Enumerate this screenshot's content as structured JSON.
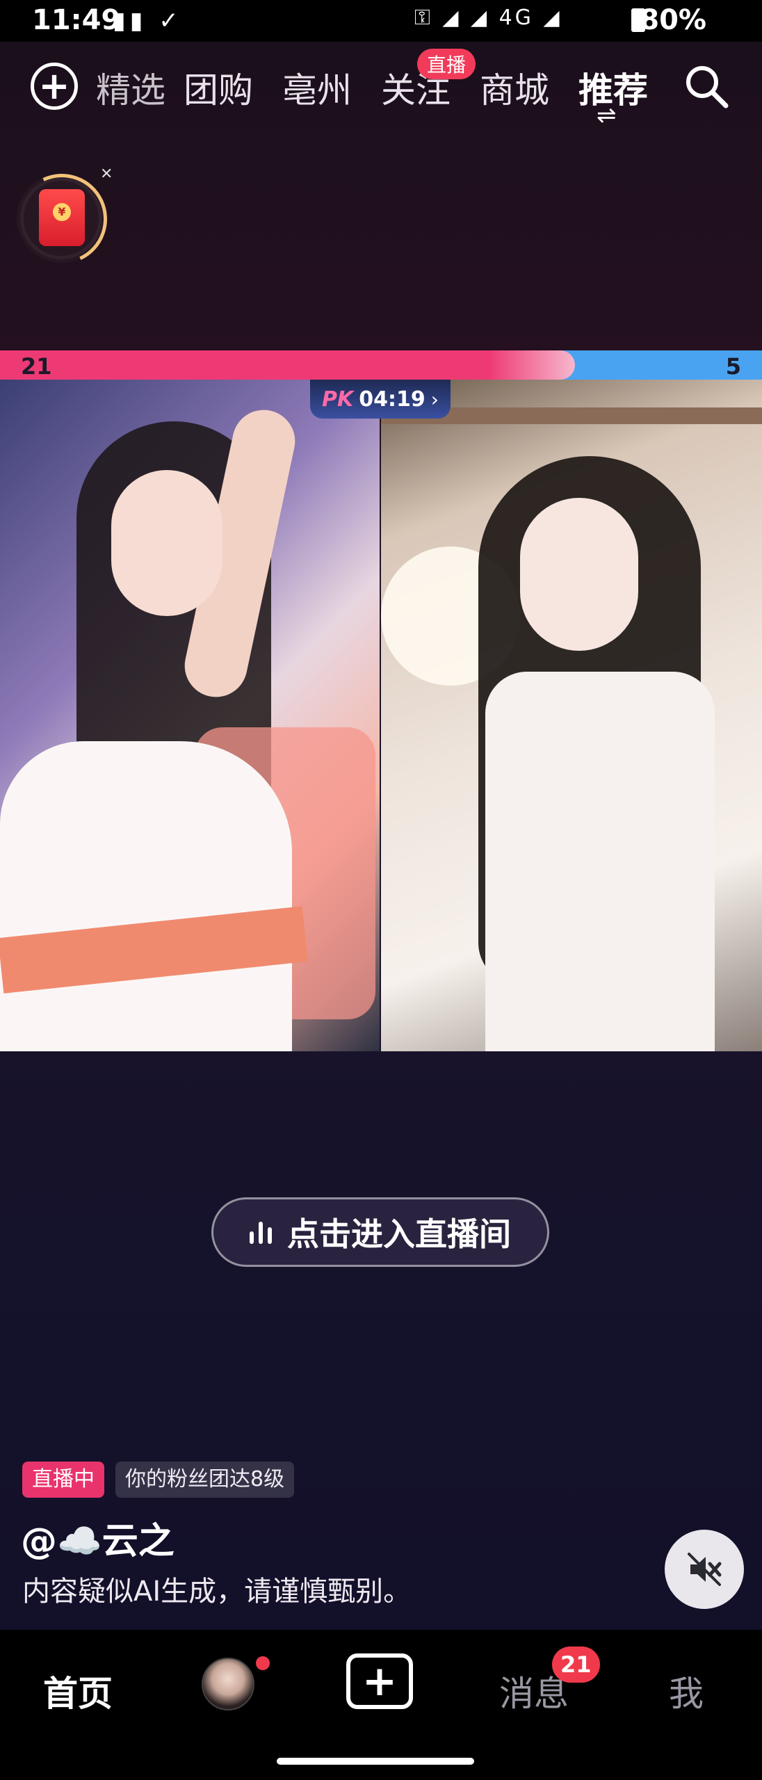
{
  "status_bar": {
    "time": "11:49",
    "battery_pct": "80%",
    "network": "4G"
  },
  "top_nav": {
    "tabs": [
      {
        "label": "精选"
      },
      {
        "label": "团购"
      },
      {
        "label": "亳州"
      },
      {
        "label": "关注"
      },
      {
        "label": "商城"
      },
      {
        "label": "推荐"
      }
    ],
    "live_badge": "直播",
    "active_tab": "推荐"
  },
  "pk": {
    "left_score": "21",
    "right_score": "5",
    "left_ratio": 0.755,
    "logo": "PK",
    "timer": "04:19",
    "colors": {
      "left": "#ee3a74",
      "right": "#4aa3f0"
    }
  },
  "enter_live": {
    "label": "点击进入直播间"
  },
  "info": {
    "live_tag": "直播中",
    "fan_tag": "你的粉丝团达8级",
    "author": "@☁️云之",
    "note": "内容疑似AI生成，请谨慎甄别。"
  },
  "tab_bar": {
    "home": "首页",
    "messages": "消息",
    "messages_badge": "21",
    "me": "我"
  },
  "icons": {
    "add": "plus-circle-icon",
    "search": "search-icon",
    "swap": "swap-icon",
    "mute": "mute-icon",
    "red_packet": "red-packet-icon",
    "live_bars": "bars-icon",
    "create": "plus-square-icon"
  }
}
